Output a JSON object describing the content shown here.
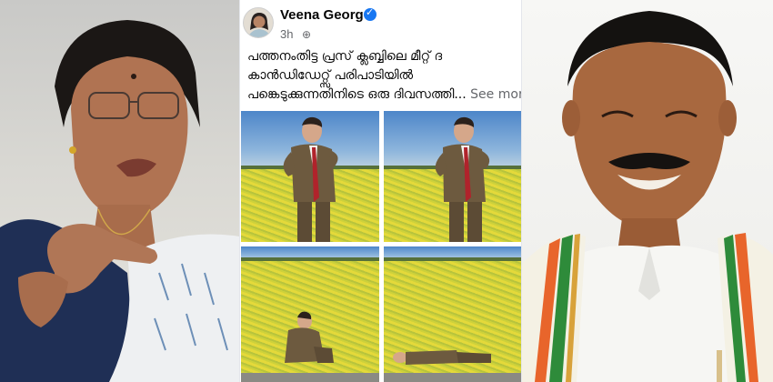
{
  "post": {
    "author": "Veena George",
    "time": "3h",
    "text_lines": [
      "പത്തനംതിട്ട പ്രസ് ക്ലബ്ബിലെ മീറ്റ് ദ",
      "കാൻഡിഡേറ്റ്സ് പരിപാടിയിൽ",
      "പങ്കെടുക്കുന്നതിനിടെ ഒരു ദിവസത്തി..."
    ],
    "see_more": "See more"
  },
  "icons": {
    "verified": "verified-badge-icon",
    "privacy": "globe-icon"
  },
  "colors": {
    "facebook_blue": "#1877f2",
    "secondary_text": "#65676b",
    "field_yellow": "#d6d23a",
    "sky_blue": "#6fa0d3",
    "kasavu_green": "#2e8b3a",
    "kasavu_orange": "#e8652b"
  }
}
